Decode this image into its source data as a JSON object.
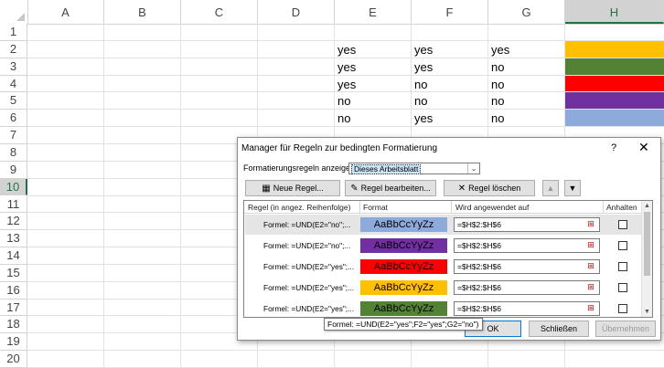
{
  "spreadsheet": {
    "columns": [
      "A",
      "B",
      "C",
      "D",
      "E",
      "F",
      "G",
      "H"
    ],
    "rows": [
      "1",
      "2",
      "3",
      "4",
      "5",
      "6",
      "7",
      "8",
      "9",
      "10",
      "11",
      "12",
      "13",
      "14",
      "15",
      "16",
      "17",
      "18",
      "19",
      "20"
    ],
    "selected_column": "H",
    "selected_row": "10",
    "data": [
      {
        "E": "yes",
        "F": "yes",
        "G": "yes",
        "fill": "#ffc000"
      },
      {
        "E": "yes",
        "F": "yes",
        "G": "no",
        "fill": "#548235"
      },
      {
        "E": "yes",
        "F": "no",
        "G": "no",
        "fill": "#ff0000"
      },
      {
        "E": "no",
        "F": "no",
        "G": "no",
        "fill": "#7030a0"
      },
      {
        "E": "no",
        "F": "yes",
        "G": "no",
        "fill": "#8eaadb"
      }
    ]
  },
  "dialog": {
    "title": "Manager für Regeln zur bedingten Formatierung",
    "help": "?",
    "close": "✕",
    "show_rules_label": "Formatierungsregeln anzeigen für:",
    "show_rules_value": "Dieses Arbeitsblatt",
    "new_rule": "Neue Regel...",
    "edit_rule": "Regel bearbeiten...",
    "delete_rule": "Regel löschen",
    "move_up": "▲",
    "move_down": "▼",
    "col_rule": "Regel (in angez. Reihenfolge)",
    "col_format": "Format",
    "col_applies": "Wird angewendet auf",
    "col_stop": "Anhalten",
    "preview_text": "AaBbCcYyZz",
    "rules": [
      {
        "formula": "Formel: =UND(E2=\"no\";...",
        "color": "#8eaadb",
        "range": "=$H$2:$H$6"
      },
      {
        "formula": "Formel: =UND(E2=\"no\";...",
        "color": "#7030a0",
        "range": "=$H$2:$H$6"
      },
      {
        "formula": "Formel: =UND(E2=\"yes\";...",
        "color": "#ff0000",
        "range": "=$H$2:$H$6"
      },
      {
        "formula": "Formel: =UND(E2=\"yes\";...",
        "color": "#ffc000",
        "range": "=$H$2:$H$6"
      },
      {
        "formula": "Formel: =UND(E2=\"yes\";...",
        "color": "#548235",
        "range": "=$H$2:$H$6"
      }
    ],
    "ok": "OK",
    "close_btn": "Schließen",
    "apply": "Übernehmen",
    "tooltip": "Formel: =UND(E2=\"yes\";F2=\"yes\";G2=\"no\")"
  }
}
